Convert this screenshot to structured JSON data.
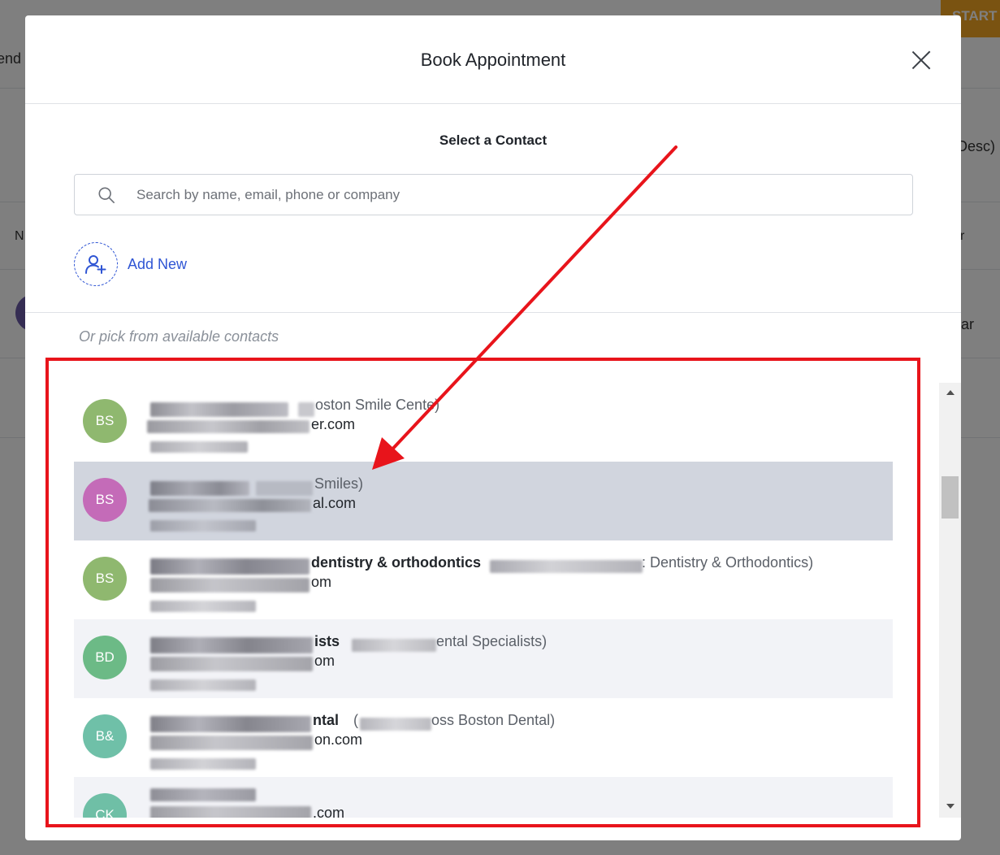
{
  "background": {
    "header_fragment": "end",
    "start_button": "START",
    "sort_fragment": "Desc)",
    "col_left_fragment": "N",
    "col_right_fragment": "r",
    "row_fragment": "ar"
  },
  "modal": {
    "title": "Book Appointment",
    "subtitle": "Select a Contact",
    "search": {
      "placeholder": "Search by name, email, phone or company",
      "value": ""
    },
    "add_new_label": "Add New",
    "pick_label": "Or pick from available contacts",
    "contacts": [
      {
        "initials": "BS",
        "avatar_color": "#8fb86f",
        "name": "",
        "company": "oston Smile Cente)",
        "email": "er.com",
        "selected": false
      },
      {
        "initials": "BS",
        "avatar_color": "#c46bb8",
        "name": "",
        "company": "Smiles)",
        "email": "al.com",
        "selected": true
      },
      {
        "initials": "BS",
        "avatar_color": "#8fb86f",
        "name": "dentistry & orthodontics",
        "company": ": Dentistry & Orthodontics)",
        "email": "om",
        "selected": false
      },
      {
        "initials": "BD",
        "avatar_color": "#6cba86",
        "name": "ists",
        "company": "ental Specialists)",
        "email": "om",
        "selected": false
      },
      {
        "initials": "B&",
        "avatar_color": "#6fc0a8",
        "name": "ntal",
        "company": "oss Boston Dental)",
        "email": "on.com",
        "selected": false
      },
      {
        "initials": "CK",
        "avatar_color": "#6fbfa6",
        "name": "",
        "company": "",
        "email": ".com",
        "selected": false
      }
    ]
  },
  "colors": {
    "accent": "#2f55d4",
    "selected_row": "#d1d5de",
    "alt_row": "#f2f3f7",
    "annotation": "#e8141b"
  }
}
